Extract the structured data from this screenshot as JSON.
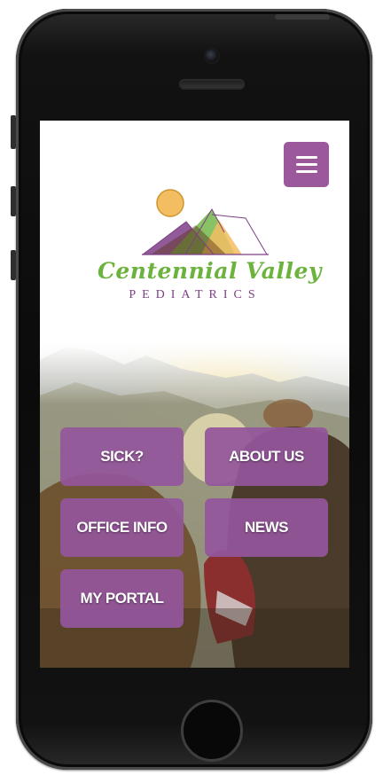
{
  "brand": {
    "name": "Centennial Valley",
    "subtitle": "PEDIATRICS",
    "name_color": "#6cb33e",
    "subtitle_color": "#7c3f83"
  },
  "header": {
    "menu_icon": "hamburger-menu-icon",
    "accent_color": "#9b599c"
  },
  "tiles": [
    {
      "label": "SICK?"
    },
    {
      "label": "ABOUT US"
    },
    {
      "label": "OFFICE INFO"
    },
    {
      "label": "NEWS"
    },
    {
      "label": "MY PORTAL"
    }
  ]
}
